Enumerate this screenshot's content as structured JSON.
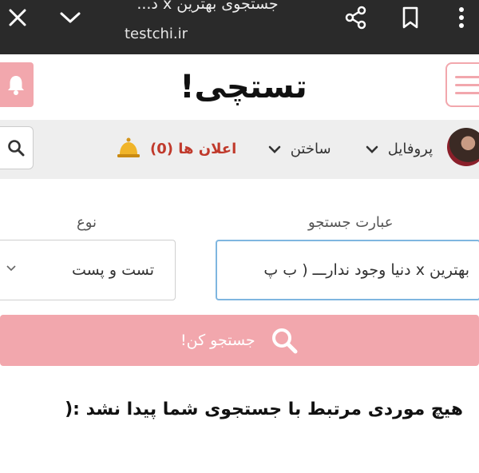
{
  "browser": {
    "title": "جستجوی بهترین x د...",
    "url": "testchi.ir",
    "icons": [
      "close-icon",
      "chevron-down-icon",
      "share-icon",
      "bookmark-icon",
      "more-vert-icon"
    ]
  },
  "header": {
    "logo": "تستچی!",
    "icons": [
      "bell-icon",
      "hamburger-icon"
    ]
  },
  "nav": {
    "announcements": "اعلان ها (0)",
    "build": "ساختن",
    "profile": "پروفایل",
    "icons": [
      "search-icon",
      "bell-gold-icon",
      "chevron-down-icon"
    ]
  },
  "form": {
    "query_label": "عبارت جستجو",
    "query_value": "بهترین x دنیا وجود ندارـــ ( ب پ",
    "type_label": "نوع",
    "type_selected": "تست و پست",
    "search_button": "جستجو کن!"
  },
  "result": {
    "message": "هیچ موردی مرتبط با جستجوی شما پیدا نشد :("
  },
  "colors": {
    "brand_pink": "#f2a7ad",
    "browser_bar": "#2a2a2a",
    "nav_bg": "#eeeeee",
    "input_focus": "#7fb6e0",
    "announce_red": "#c0392b"
  }
}
